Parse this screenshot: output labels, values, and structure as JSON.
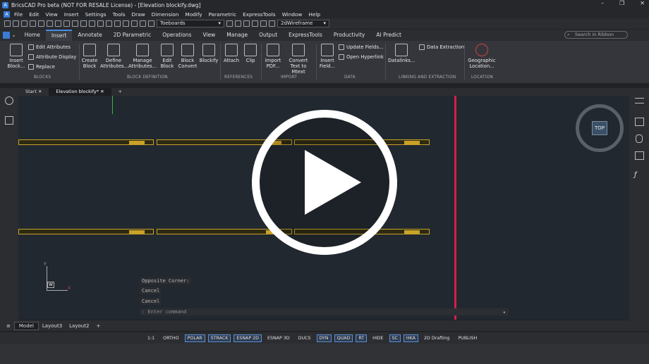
{
  "window": {
    "title": "BricsCAD Pro beta (NOT FOR RESALE License) - [Elevation blockify.dwg]",
    "min": "–",
    "max": "❐",
    "close": "✕"
  },
  "menu": [
    "File",
    "Edit",
    "View",
    "Insert",
    "Settings",
    "Tools",
    "Draw",
    "Dimension",
    "Modify",
    "Parametric",
    "ExpressTools",
    "Window",
    "Help"
  ],
  "qat": {
    "layer": "Toeboards",
    "visual_style": "2dWireframe"
  },
  "ribbon_tabs": [
    "Home",
    "Insert",
    "Annotate",
    "2D Parametric",
    "Operations",
    "View",
    "Manage",
    "Output",
    "ExpressTools",
    "Productivity",
    "AI Predict"
  ],
  "active_tab": "Insert",
  "search_placeholder": "Search in Ribbon",
  "ribbon": {
    "insert_block": "Insert Block...",
    "edit_attributes": "Edit Attributes",
    "attribute_display": "Attribute Display",
    "replace": "Replace",
    "create_block": "Create Block",
    "define_attributes": "Define Attributes...",
    "manage_attributes": "Manage Attributes...",
    "edit_block": "Edit Block",
    "block_convert": "Block Convert",
    "blockify": "Blockify",
    "attach": "Attach",
    "clip": "Clip",
    "import_pdf": "Import PDF...",
    "convert_text": "Convert Text to Mtext",
    "insert_field": "Insert Field...",
    "update_fields": "Update Fields...",
    "open_hyperlink": "Open Hyperlink",
    "datalinks": "Datalinks...",
    "data_extraction": "Data Extraction",
    "geo_location": "Geographic Location..."
  },
  "groups": [
    "BLOCKS",
    "BLOCK DEFINITION",
    "REFERENCES",
    "IMPORT",
    "DATA",
    "LINKING AND EXTRACTION",
    "LOCATION"
  ],
  "doc_tabs": [
    "Start",
    "Elevation blockify*"
  ],
  "viewcube": "TOP",
  "ucs": {
    "y": "Y",
    "w": "W",
    "x": "X"
  },
  "command_history": [
    "Opposite Corner:",
    "Cancel",
    "Cancel"
  ],
  "command_placeholder": ": Enter command",
  "layout_tabs": [
    "Model",
    "Layout3",
    "Layout2"
  ],
  "status": [
    "1:1",
    "ORTHO",
    "POLAR",
    "STRACK",
    "ESNAP 2D",
    "ESNAP 3D",
    "DUCS",
    "DYN",
    "QUAD",
    "RT",
    "HIDE",
    "SC",
    "HKA",
    "2D Drafting",
    "PUBLISH"
  ]
}
